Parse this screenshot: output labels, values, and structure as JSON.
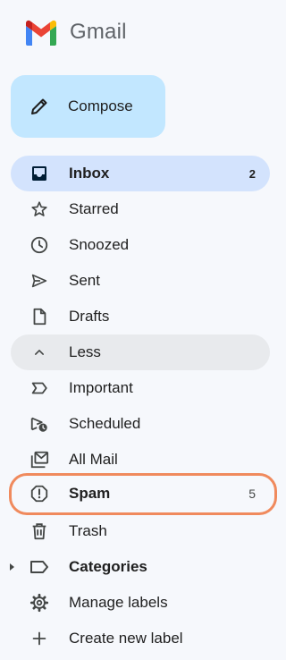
{
  "app": {
    "name": "Gmail"
  },
  "compose": {
    "label": "Compose"
  },
  "nav": [
    {
      "label": "Inbox",
      "count": "2",
      "icon": "inbox-icon"
    },
    {
      "label": "Starred",
      "icon": "star-icon"
    },
    {
      "label": "Snoozed",
      "icon": "clock-icon"
    },
    {
      "label": "Sent",
      "icon": "send-icon"
    },
    {
      "label": "Drafts",
      "icon": "draft-icon"
    },
    {
      "label": "Less",
      "icon": "chevron-up-icon"
    },
    {
      "label": "Important",
      "icon": "important-icon"
    },
    {
      "label": "Scheduled",
      "icon": "scheduled-icon"
    },
    {
      "label": "All Mail",
      "icon": "all-mail-icon"
    },
    {
      "label": "Spam",
      "count": "5",
      "icon": "spam-icon"
    },
    {
      "label": "Trash",
      "icon": "trash-icon"
    },
    {
      "label": "Categories",
      "icon": "label-icon"
    },
    {
      "label": "Manage labels",
      "icon": "gear-icon"
    },
    {
      "label": "Create new label",
      "icon": "plus-icon"
    }
  ],
  "colors": {
    "active_bg": "#d3e3fd",
    "compose_bg": "#c2e7ff",
    "highlight_ring": "#f08a5d",
    "logo": [
      "#ea4335",
      "#4285f4",
      "#34a853",
      "#fbbc05",
      "#c5221f"
    ]
  }
}
